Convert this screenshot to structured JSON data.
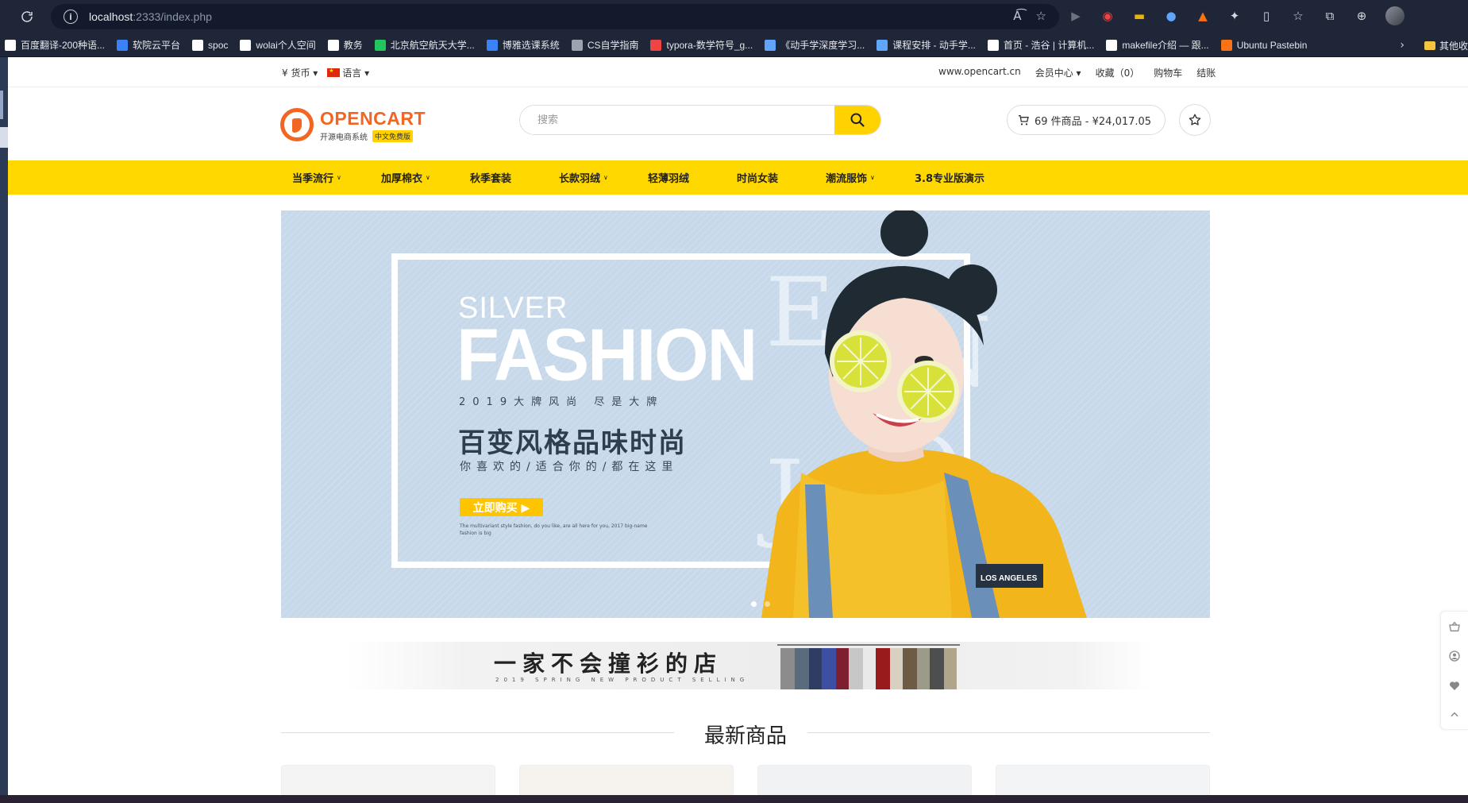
{
  "browser": {
    "url_host": "localhost",
    "url_rest": ":2333/index.php",
    "bookmarks": [
      {
        "label": "百度翻译-200种语...",
        "color": "#ffffff"
      },
      {
        "label": "软院云平台",
        "color": "#3b82f6"
      },
      {
        "label": "spoc",
        "color": "#ffffff"
      },
      {
        "label": "wolai个人空间",
        "color": "#ffffff"
      },
      {
        "label": "教务",
        "color": "#ffffff"
      },
      {
        "label": "北京航空航天大学...",
        "color": "#22c55e"
      },
      {
        "label": "博雅选课系统",
        "color": "#3b82f6"
      },
      {
        "label": "CS自学指南",
        "color": "#9ca3af"
      },
      {
        "label": "typora-数学符号_g...",
        "color": "#ef4444"
      },
      {
        "label": "《动手学深度学习...",
        "color": "#60a5fa"
      },
      {
        "label": "课程安排 - 动手学...",
        "color": "#60a5fa"
      },
      {
        "label": "首页 - 浩谷 | 计算机...",
        "color": "#ffffff"
      },
      {
        "label": "makefile介绍 — 跟...",
        "color": "#ffffff"
      },
      {
        "label": "Ubuntu Pastebin",
        "color": "#f97316"
      }
    ],
    "bookmarks_folder": "其他收"
  },
  "topbar": {
    "currency": "¥ 货币",
    "language": "语言",
    "site": "www.opencart.cn",
    "account": "会员中心",
    "wishlist": "收藏（0）",
    "cart": "购物车",
    "checkout": "结账"
  },
  "header": {
    "logo_title": "OPENCART",
    "logo_subtitle": "开源电商系统",
    "logo_badge": "中文免费版",
    "search_placeholder": "搜索",
    "cart_summary": "69 件商品 - ¥24,017.05"
  },
  "nav": [
    {
      "label": "当季流行",
      "dropdown": true
    },
    {
      "label": "加厚棉衣",
      "dropdown": true
    },
    {
      "label": "秋季套装",
      "dropdown": false
    },
    {
      "label": "长款羽绒",
      "dropdown": true
    },
    {
      "label": "轻薄羽绒",
      "dropdown": false
    },
    {
      "label": "时尚女装",
      "dropdown": false
    },
    {
      "label": "潮流服饰",
      "dropdown": true
    },
    {
      "label": "3.8专业版演示",
      "dropdown": false
    }
  ],
  "banner": {
    "silver": "SILVER",
    "fashion": "FASHION",
    "tagline": "2019大牌风尚 尽是大牌",
    "title": "百变风格品味时尚",
    "subtitle": "你喜欢的/适合你的/都在这里",
    "button": "立即购买 ▶",
    "fine_print": "The multivariant style fashion, do you like, are all here for you, 2017 big-name fashion is big"
  },
  "promo": {
    "text": "一家不会撞衫的店",
    "sub": "2019 SPRING NEW PRODUCT SELLING"
  },
  "section": {
    "title": "最新商品"
  },
  "colors": {
    "accent": "#ffd800",
    "brand": "#f26522"
  }
}
